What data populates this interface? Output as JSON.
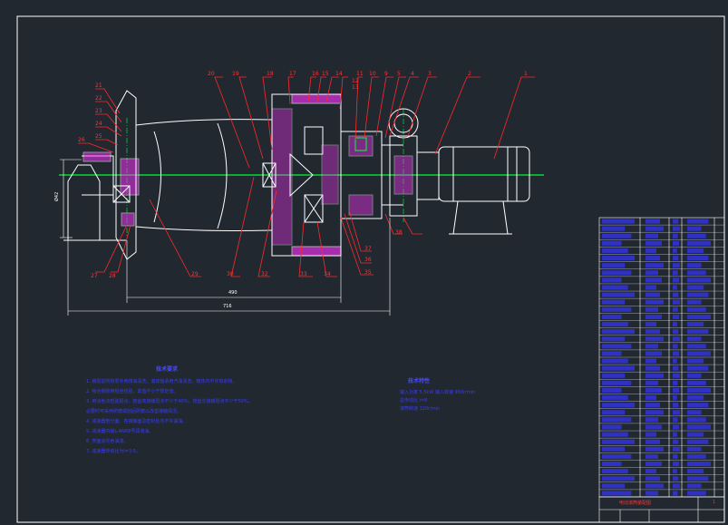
{
  "colors": {
    "background": "#212830",
    "frame": "#ffffff",
    "leader": "#ff2a2a",
    "centerline": "#00ff33",
    "hatch": "#ff33ff",
    "text": "#3b3bff",
    "outline": "#ffffff"
  },
  "part_numbers": [
    "1",
    "2",
    "3",
    "4",
    "5",
    "9",
    "10",
    "11",
    "12",
    "13",
    "14",
    "15",
    "16",
    "17",
    "18",
    "19",
    "20",
    "21",
    "22",
    "23",
    "24",
    "25",
    "26",
    "27",
    "28",
    "29",
    "30",
    "32",
    "33",
    "34",
    "35",
    "36",
    "37",
    "38"
  ],
  "dimensions": {
    "height": "Ø42",
    "inner_length": "490",
    "overall_length": "716"
  },
  "notes": {
    "tech_title": "技术要求",
    "tech_lines": [
      "1. 装配前所有零件用煤油清洗，滚动轴承用汽油清洗，箱体内不许有杂物。",
      "2. 啮合侧隙用铅丝检验，其值不小于规定值。",
      "3. 用涂色法检验斑点，按齿高接触斑点不少于40%，按齿长接触斑点不少于50%，",
      "   必要时可采用研磨或刮后研磨以改善接触情况。",
      "4. 减速器剖分面、各接触面及密封处均不许漏油。",
      "5. 减速器内装L-AN68号润滑油。",
      "6. 表面涂灰色油漆。",
      "7. 减速器传动比为i=3.5。"
    ],
    "spec_title": "技术特性",
    "spec_lines": [
      "输入功率 5.5kW  输入转速 960r/min",
      "总传动比 i=8",
      "滚筒转速 120r/min"
    ]
  },
  "title_block": {
    "title": "电动滚筒装配图",
    "sheet_mark": "1"
  }
}
